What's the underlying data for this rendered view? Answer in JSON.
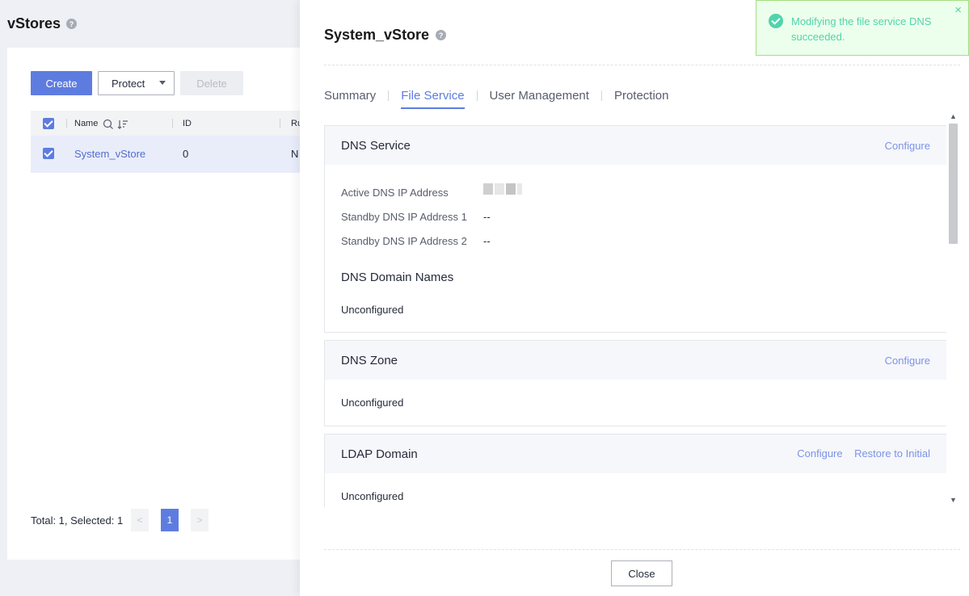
{
  "background": {
    "title": "vStores",
    "buttons": {
      "create": "Create",
      "protect": "Protect",
      "delete": "Delete"
    },
    "table": {
      "headers": {
        "name": "Name",
        "id": "ID",
        "running": "Ru"
      },
      "rows": [
        {
          "name": "System_vStore",
          "id": "0",
          "running": "N"
        }
      ]
    },
    "pagination": {
      "summary": "Total: 1, Selected: 1",
      "current_page": "1",
      "prev": "<",
      "next": ">"
    }
  },
  "panel": {
    "title": "System_vStore",
    "tabs": [
      "Summary",
      "File Service",
      "User Management",
      "Protection"
    ],
    "active_tab": "File Service",
    "dns_service": {
      "title": "DNS Service",
      "configure": "Configure",
      "active_label": "Active DNS IP Address",
      "standby1_label": "Standby DNS IP Address 1",
      "standby1_value": "--",
      "standby2_label": "Standby DNS IP Address 2",
      "standby2_value": "--",
      "domain_names_title": "DNS Domain Names",
      "domain_names_value": "Unconfigured"
    },
    "dns_zone": {
      "title": "DNS Zone",
      "configure": "Configure",
      "value": "Unconfigured"
    },
    "ldap_domain": {
      "title": "LDAP Domain",
      "configure": "Configure",
      "restore": "Restore to Initial",
      "value": "Unconfigured"
    },
    "close_button": "Close"
  },
  "toast": {
    "message": "Modifying the file service DNS succeeded.",
    "close": "×"
  },
  "icons": {
    "help": "help-circle-icon",
    "search": "search-icon",
    "sort": "sort-icon",
    "success": "check-circle-icon"
  },
  "colors": {
    "brand": "#5e7ce0",
    "success": "#50d4ab",
    "link": "#7c93e6"
  }
}
